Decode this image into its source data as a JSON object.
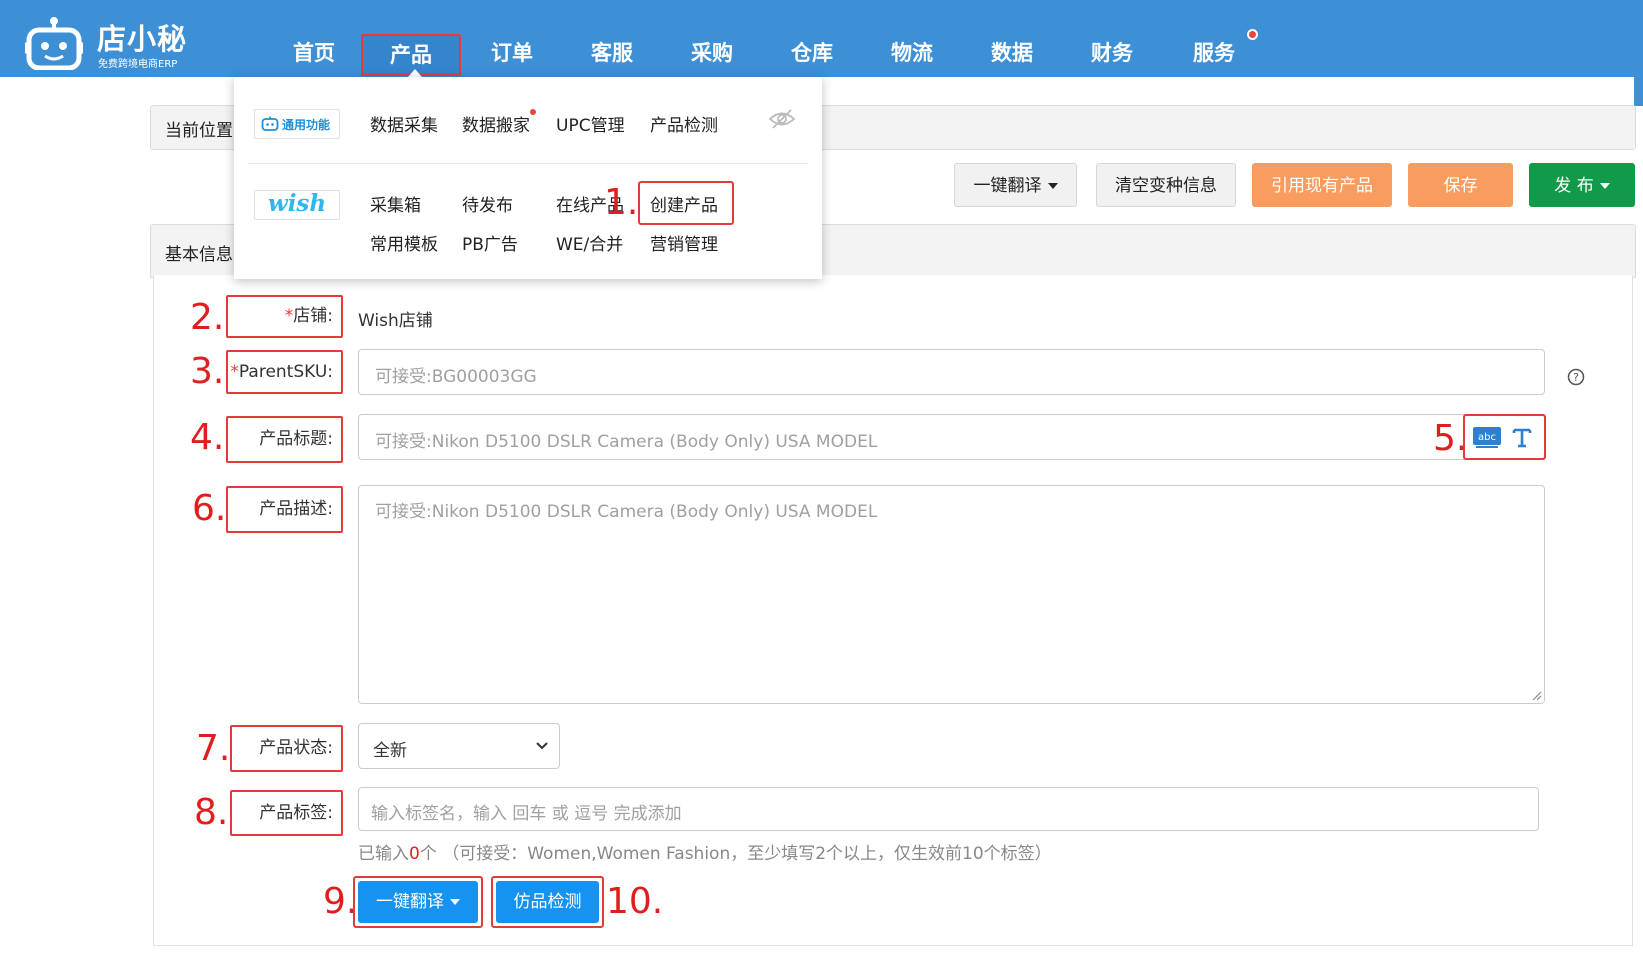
{
  "app": {
    "brand_name": "店小秘",
    "brand_sub": "免费跨境电商ERP"
  },
  "nav": {
    "items": [
      {
        "label": "首页"
      },
      {
        "label": "产品"
      },
      {
        "label": "订单"
      },
      {
        "label": "客服"
      },
      {
        "label": "采购"
      },
      {
        "label": "仓库"
      },
      {
        "label": "物流"
      },
      {
        "label": "数据"
      },
      {
        "label": "财务"
      },
      {
        "label": "服务"
      }
    ],
    "active": "产品",
    "badge_color": "#e8473f"
  },
  "dropdown": {
    "general_tag": "通用功能",
    "general_links": [
      "数据采集",
      "数据搬家",
      "UPC管理",
      "产品检测"
    ],
    "wish_tag": "wish",
    "wish_links_row1": [
      "采集箱",
      "待发布",
      "在线产品",
      "创建产品"
    ],
    "wish_links_row2": [
      "常用模板",
      "PB广告",
      "WE/合并",
      "营销管理"
    ],
    "hide_icon": "eye-slash-icon"
  },
  "breadcrumb": {
    "label": "当前位置"
  },
  "section": {
    "label": "基本信息"
  },
  "toolbar": {
    "translate_label": "一键翻译",
    "clear_variants_label": "清空变种信息",
    "reference_label": "引用现有产品",
    "save_label": "保存",
    "publish_label": "发 布"
  },
  "form": {
    "store": {
      "label": "店铺:",
      "value": "Wish店铺"
    },
    "parent_sku": {
      "label": "ParentSKU:",
      "placeholder": "可接受:BG00003GG"
    },
    "title": {
      "label": "产品标题:",
      "placeholder": "可接受:Nikon D5100 DSLR Camera (Body Only) USA MODEL"
    },
    "description": {
      "label": "产品描述:",
      "placeholder": "可接受:Nikon D5100 DSLR Camera (Body Only) USA MODEL"
    },
    "status": {
      "label": "产品状态:",
      "value": "全新"
    },
    "tags": {
      "label": "产品标签:",
      "placeholder": "输入标签名，输入 回车 或 逗号 完成添加",
      "hint_prefix": "已输入",
      "count": "0",
      "hint_suffix": "个 （可接受：Women,Women Fashion，至少填写2个以上，仅生效前10个标签）"
    },
    "required_mark": "*",
    "translate_btn": "一键翻译",
    "check_btn": "仿品检测"
  },
  "annotations": [
    "1.",
    "2.",
    "3.",
    "4.",
    "5.",
    "6.",
    "7.",
    "8.",
    "9.",
    "10."
  ],
  "colors": {
    "header": "#3d8fd6",
    "annotation": "#e01e1e",
    "orange": "#f89d5f",
    "green": "#119a4a",
    "blue": "#1692f0"
  }
}
